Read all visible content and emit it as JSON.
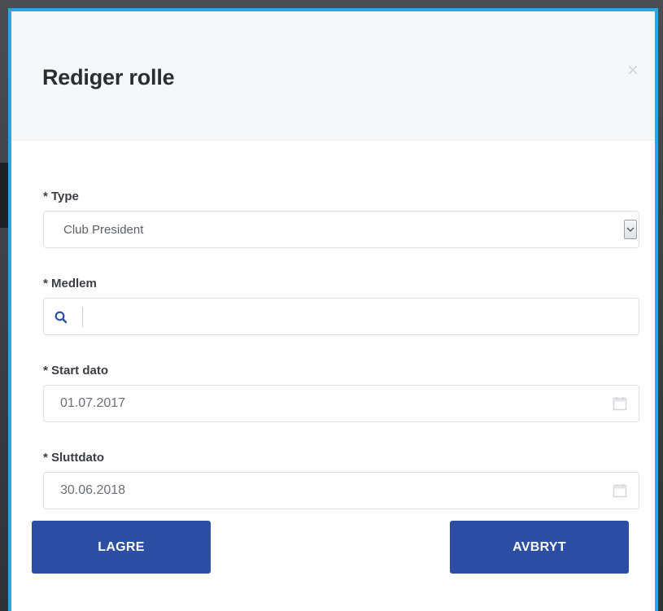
{
  "modal": {
    "title": "Rediger rolle",
    "close_icon": "close-icon"
  },
  "fields": {
    "type": {
      "label": "* Type",
      "value": "Club President"
    },
    "member": {
      "label": "* Medlem",
      "value": "",
      "placeholder": ""
    },
    "start_date": {
      "label": "* Start dato",
      "value": "01.07.2017"
    },
    "end_date": {
      "label": "* Sluttdato",
      "value": "30.06.2018"
    }
  },
  "buttons": {
    "save_label": "LAGRE",
    "cancel_label": "AVBRYT"
  },
  "colors": {
    "accent_border": "#29a7de",
    "button_primary": "#2c4fa3",
    "search_icon": "#2c4fa3"
  }
}
